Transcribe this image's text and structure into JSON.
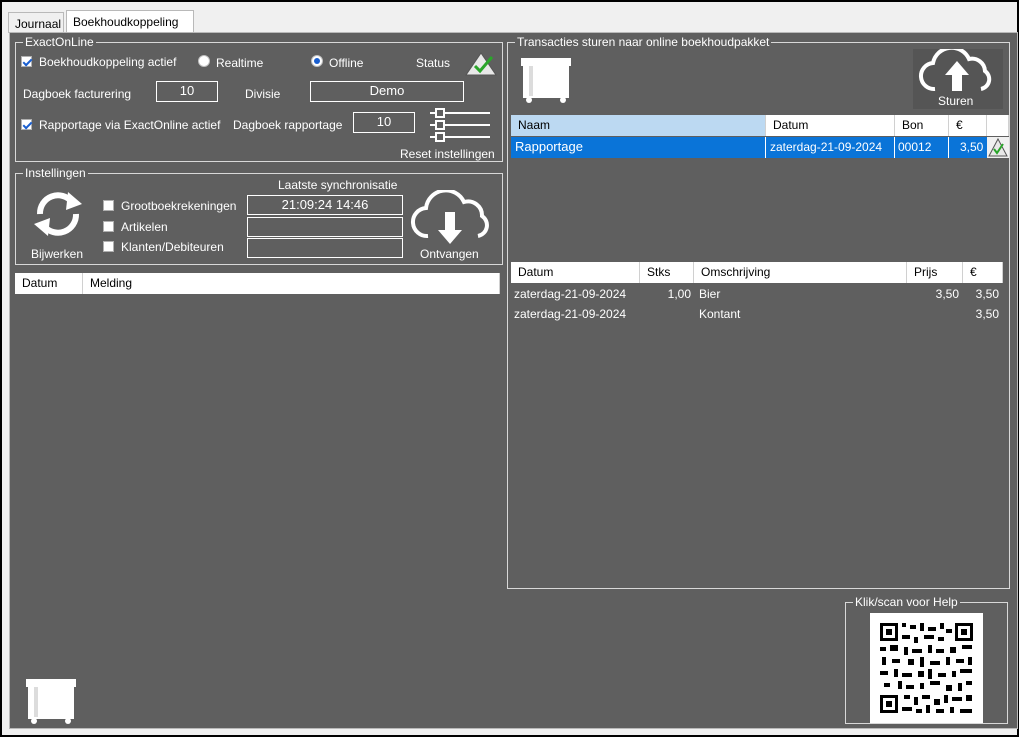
{
  "tabs": [
    "Journaal",
    "Boekhoudkoppeling"
  ],
  "exact": {
    "title": "ExactOnLine",
    "active_label": "Boekhoudkoppeling actief",
    "realtime_label": "Realtime",
    "offline_label": "Offline",
    "status_label": "Status",
    "dagboek_facturering_label": "Dagboek facturering",
    "dagboek_facturering_value": "10",
    "divisie_label": "Divisie",
    "divisie_value": "Demo",
    "rapportage_label": "Rapportage via ExactOnline actief",
    "dagboek_rapportage_label": "Dagboek rapportage",
    "dagboek_rapportage_value": "10",
    "reset_label": "Reset instellingen"
  },
  "instellingen": {
    "title": "Instellingen",
    "sync_header": "Laatste synchronisatie",
    "bijwerken_label": "Bijwerken",
    "ontvangen_label": "Ontvangen",
    "items": [
      {
        "label": "Grootboekrekeningen",
        "sync": "21:09:24 14:46"
      },
      {
        "label": "Artikelen",
        "sync": ""
      },
      {
        "label": "Klanten/Debiteuren",
        "sync": ""
      }
    ]
  },
  "log_table": {
    "headers": [
      "Datum",
      "Melding"
    ]
  },
  "transacties": {
    "title": "Transacties sturen  naar online boekhoudpakket",
    "sturen_label": "Sturen",
    "headers": [
      "Naam",
      "Datum",
      "Bon",
      "€"
    ],
    "rows": [
      {
        "naam": "Rapportage",
        "datum": "zaterdag-21-09-2024",
        "bon": "00012",
        "bedrag": "3,50"
      }
    ],
    "detail_headers": [
      "Datum",
      "Stks",
      "Omschrijving",
      "Prijs",
      "€"
    ],
    "detail_rows": [
      {
        "datum": "zaterdag-21-09-2024",
        "stks": "1,00",
        "omschrijving": "Bier",
        "prijs": "3,50",
        "bedrag": "3,50"
      },
      {
        "datum": "zaterdag-21-09-2024",
        "stks": "",
        "omschrijving": "Kontant",
        "prijs": "",
        "bedrag": "3,50"
      }
    ]
  },
  "help": {
    "title": "Klik/scan voor Help"
  },
  "colors": {
    "panel": "#5f5f5f",
    "selection": "#0a74d8",
    "header_selected": "#bcd9f2",
    "status_green": "#2aa52a"
  }
}
